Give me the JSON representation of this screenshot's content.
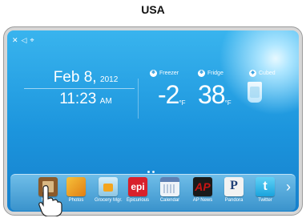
{
  "caption": "USA",
  "status_icons": [
    {
      "icon": "close-icon",
      "glyph": "✕"
    },
    {
      "icon": "speaker-icon",
      "glyph": "◁"
    },
    {
      "icon": "network-icon",
      "glyph": "⌖"
    }
  ],
  "clock": {
    "date": "Feb 8,",
    "year": "2012",
    "time": "11:23",
    "ampm": "AM"
  },
  "compartments": [
    {
      "label": "Freezer",
      "temp": "-2",
      "unit": "°F"
    },
    {
      "label": "Fridge",
      "temp": "38",
      "unit": "°F"
    },
    {
      "label": "Cubed"
    }
  ],
  "dock": {
    "apps": [
      {
        "label": "Memo",
        "icon": "memo-icon",
        "color": "#8a5a2b"
      },
      {
        "label": "Photos",
        "icon": "photos-icon",
        "color": "#e8a41c"
      },
      {
        "label": "Grocery Mgr.",
        "icon": "grocery-icon",
        "color": "#9fd2ea"
      },
      {
        "label": "Epicurious",
        "icon": "epicurious-icon",
        "color": "#d8202b",
        "text": "epi"
      },
      {
        "label": "Calendar",
        "icon": "calendar-icon",
        "color": "#e8eef5"
      },
      {
        "label": "AP News",
        "icon": "ap-news-icon",
        "color": "#c81414",
        "text": "AP"
      },
      {
        "label": "Pandora",
        "icon": "pandora-icon",
        "color": "#eeeeee",
        "text": "P"
      },
      {
        "label": "Twitter",
        "icon": "twitter-icon",
        "color": "#2fb7ec",
        "text": "t"
      }
    ],
    "next_glyph": "›"
  }
}
